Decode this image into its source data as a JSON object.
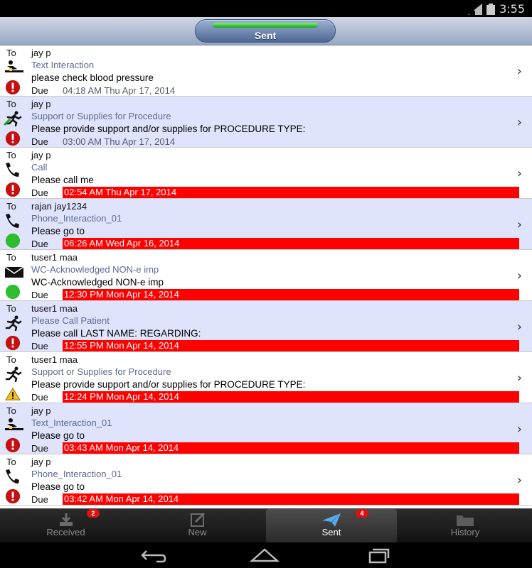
{
  "status_bar": {
    "time": "3:55"
  },
  "header": {
    "title": "Sent"
  },
  "labels": {
    "to": "To",
    "due": "Due"
  },
  "rows": [
    {
      "to_name": "jay p",
      "type": "Text Interaction",
      "message": "please check blood pressure",
      "due_date": "04:18 AM Thu Apr 17, 2014"
    },
    {
      "to_name": "jay p",
      "type": "Support or Supplies for Procedure",
      "message": "Please provide support and/or supplies for PROCEDURE TYPE:",
      "due_date": "03:00 AM Thu Apr 17, 2014"
    },
    {
      "to_name": "jay p",
      "type": "Call",
      "message": "Please call me",
      "due_date": "02:54 AM Thu Apr 17, 2014"
    },
    {
      "to_name": "rajan jay1234",
      "type": "Phone_Interaction_01",
      "message": "Please go to",
      "due_date": "06:26 AM Wed Apr 16, 2014"
    },
    {
      "to_name": "tuser1 maa",
      "type": "WC-Acknowledged NON-e imp",
      "message": "WC-Acknowledged NON-e imp",
      "due_date": "12:30 PM Mon Apr 14, 2014"
    },
    {
      "to_name": "tuser1 maa",
      "type": "Please Call Patient",
      "message": "Please call LAST NAME: REGARDING:",
      "due_date": "12:55 PM Mon Apr 14, 2014"
    },
    {
      "to_name": "tuser1 maa",
      "type": "Support or Supplies for Procedure",
      "message": "Please provide support and/or supplies for PROCEDURE TYPE:",
      "due_date": "12:24 PM Mon Apr 14, 2014"
    },
    {
      "to_name": "jay p",
      "type": "Text_Interaction_01",
      "message": "Please go to",
      "due_date": "03:43 AM Mon Apr 14, 2014"
    },
    {
      "to_name": "jay p",
      "type": "Phone_Interaction_01",
      "message": "Please go to",
      "due_date": "03:42 AM Mon Apr 14, 2014"
    }
  ],
  "tabs": [
    {
      "label": "Received",
      "badge": "2"
    },
    {
      "label": "New"
    },
    {
      "label": "Sent",
      "badge": "4"
    },
    {
      "label": "History"
    }
  ],
  "colors": {
    "overdue": "#ff0000",
    "alt_row": "#dfe3fb",
    "type_text": "#5b6c96"
  }
}
